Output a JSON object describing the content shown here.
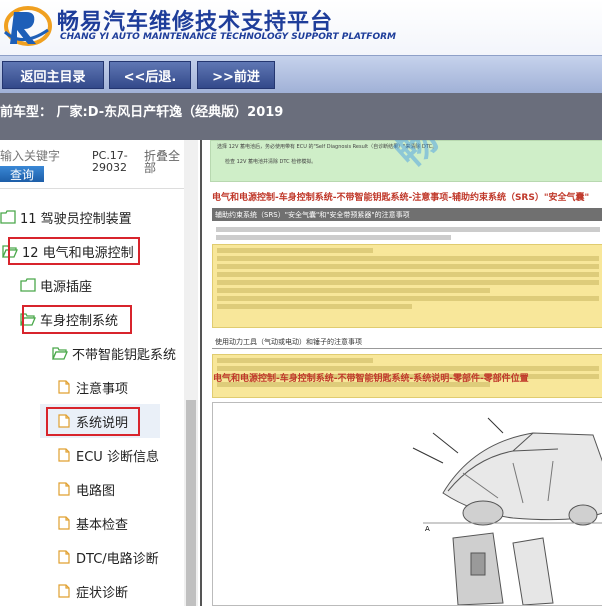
{
  "header": {
    "title_cn": "畅易汽车维修技术支持平台",
    "title_en": "CHANG YI AUTO MAINTENANCE TECHNOLOGY SUPPORT PLATFORM"
  },
  "nav": {
    "home": "返回主目录",
    "back": "<<后退.",
    "forward": ">>前进"
  },
  "vehicle_line": "前车型： 厂家:D-东风日产轩逸（经典版）2019",
  "search": {
    "placeholder": "输入关键字",
    "button": "查询",
    "pc_code": "PC.17-29032",
    "collapse_all": "折叠全部"
  },
  "tree": {
    "items": [
      {
        "label": "11 驾驶员控制装置",
        "type": "folder"
      },
      {
        "label": "12 电气和电源控制",
        "type": "folder-open"
      },
      {
        "label": "电源插座",
        "type": "folder"
      },
      {
        "label": "车身控制系统",
        "type": "folder-open"
      },
      {
        "label": "不带智能钥匙系统",
        "type": "folder-open"
      },
      {
        "label": "注意事项",
        "type": "doc"
      },
      {
        "label": "系统说明",
        "type": "doc"
      },
      {
        "label": "ECU 诊断信息",
        "type": "doc"
      },
      {
        "label": "电路图",
        "type": "doc"
      },
      {
        "label": "基本检查",
        "type": "doc"
      },
      {
        "label": "DTC/电路诊断",
        "type": "doc"
      },
      {
        "label": "症状诊断",
        "type": "doc"
      }
    ]
  },
  "document": {
    "watermark": "畅易汽",
    "note_text": "选择 12V 蓄电池后，务必使用带有 ECU 的\"Self Diagnosis Result（自诊断结果）\"来清除 DTC。",
    "note_text2": "检查 12V 蓄电池并清除 DTC 检修模拟。",
    "section1": "电气和电源控制-车身控制系统-不带智能钥匙系统-注意事项-辅助约束系统（SRS）\"安全气囊\"",
    "band1": "辅助约束系统（SRS）\"安全气囊\"和\"安全带预紧器\"的注意事项",
    "band2": "使用动力工具（气动或电动）和锤子的注意事项",
    "section2": "电气和电源控制-车身控制系统-不带智能钥匙系统-系统说明-零部件-零部件位置",
    "figure_label": "A"
  },
  "colors": {
    "brand_blue": "#1e3d9a",
    "highlight_red": "#d8242c",
    "section_red": "#c0392b",
    "note_green": "#cfeec8",
    "note_yellow": "#f8e79a"
  }
}
